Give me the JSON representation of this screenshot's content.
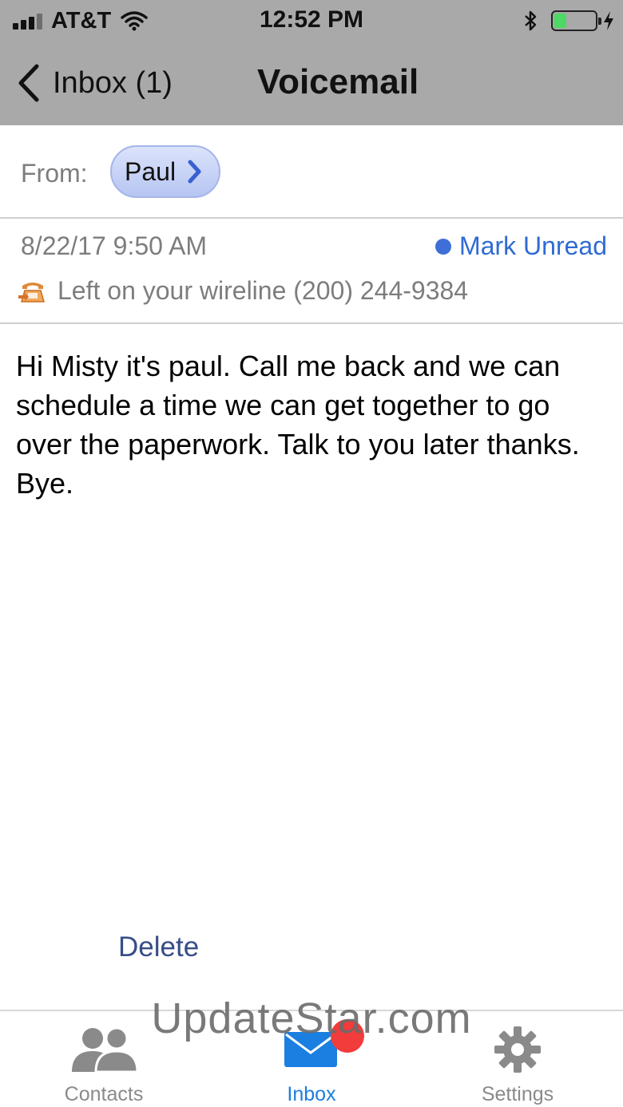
{
  "status_bar": {
    "carrier": "AT&T",
    "time": "12:52 PM",
    "battery_level": 0.3,
    "battery_color": "#4cd964"
  },
  "nav": {
    "back_label": "Inbox (1)",
    "title": "Voicemail"
  },
  "from": {
    "label": "From:",
    "contact": "Paul"
  },
  "meta": {
    "date": "8/22/17 9:50 AM",
    "mark_unread": "Mark Unread",
    "line_info": "Left on your wireline (200) 244-9384"
  },
  "message": {
    "transcript": "Hi Misty it's paul. Call me back and we can schedule a time we can get together to go over the paperwork. Talk to you later thanks. Bye."
  },
  "actions": {
    "delete_label": "Delete"
  },
  "tabs": [
    {
      "label": "Contacts",
      "icon": "contacts-icon",
      "color": "#8a8a8a"
    },
    {
      "label": "Inbox",
      "icon": "envelope-icon",
      "color": "#1a7fe0"
    },
    {
      "label": "Settings",
      "icon": "gear-icon",
      "color": "#8a8a8a"
    }
  ],
  "watermark": "UpdateStar.com",
  "colors": {
    "header_bg": "#a9a9a9",
    "accent_blue": "#2f6bd3",
    "badge_red": "#f23b3b",
    "delete_color": "#384d88"
  }
}
